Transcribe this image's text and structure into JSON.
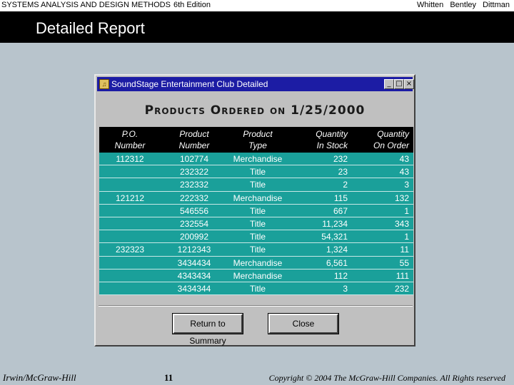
{
  "header": {
    "book_title": "SYSTEMS ANALYSIS AND DESIGN METHODS",
    "edition": "6th Edition",
    "authors": "Whitten Bentley Dittman"
  },
  "slide": {
    "title": "Detailed Report"
  },
  "window": {
    "title": "SoundStage Entertainment Club Detailed",
    "minimize_label": "_",
    "maximize_label": "□",
    "close_label": "×",
    "report_title": "Products Ordered on 1/25/2000",
    "columns": [
      "P.O.\nNumber",
      "Product\nNumber",
      "Product\nType",
      "Quantity\nIn Stock",
      "Quantity\nOn Order"
    ],
    "rows": [
      [
        "112312",
        "102774",
        "Merchandise",
        "232",
        "43"
      ],
      [
        "",
        "232322",
        "Title",
        "23",
        "43"
      ],
      [
        "",
        "232332",
        "Title",
        "2",
        "3"
      ],
      [
        "121212",
        "222332",
        "Merchandise",
        "115",
        "132"
      ],
      [
        "",
        "546556",
        "Title",
        "667",
        "1"
      ],
      [
        "",
        "232554",
        "Title",
        "11,234",
        "343"
      ],
      [
        "",
        "200992",
        "Title",
        "54,321",
        "1"
      ],
      [
        "232323",
        "1212343",
        "Title",
        "1,324",
        "11"
      ],
      [
        "",
        "3434434",
        "Merchandise",
        "6,561",
        "55"
      ],
      [
        "",
        "4343434",
        "Merchandise",
        "112",
        "111"
      ],
      [
        "",
        "3434344",
        "Title",
        "3",
        "232"
      ]
    ],
    "return_button": "Return to Summary",
    "close_button": "Close"
  },
  "footer": {
    "publisher": "Irwin/McGraw-Hill",
    "page": "11",
    "copyright": "Copyright © 2004 The McGraw-Hill Companies. All Rights reserved"
  }
}
